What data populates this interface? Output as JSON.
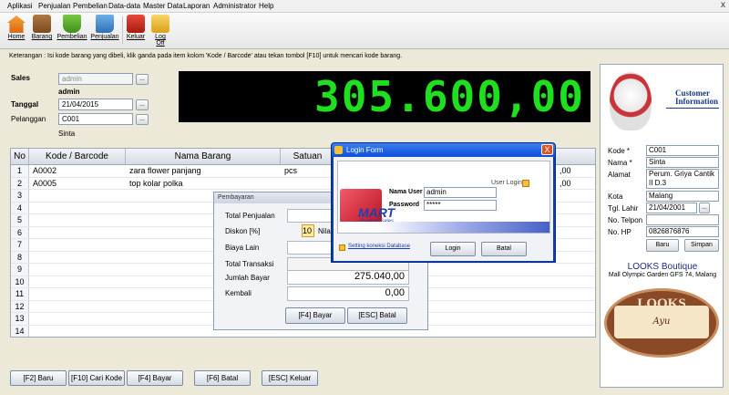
{
  "menu": {
    "items": [
      "Aplikasi",
      "Penjualan",
      "Pembelian",
      "Data-data",
      "Master Data",
      "Laporan",
      "Administrator",
      "Help"
    ],
    "close": "x"
  },
  "toolbar": {
    "buttons": [
      {
        "label": "Home",
        "icon": "home-icon"
      },
      {
        "label": "Barang",
        "icon": "box-icon"
      },
      {
        "label": "Pembelian",
        "icon": "basket-icon"
      },
      {
        "label": "Penjualan",
        "icon": "cart-icon"
      },
      {
        "label": "Keluar",
        "icon": "exit-icon"
      },
      {
        "label": "Log Off",
        "icon": "logoff-icon"
      }
    ]
  },
  "info_text": "Keterangan : Isi kode barang yang dibeli, klik ganda pada item kolom 'Kode / Barcode' atau tekan tombol [F10] untuk mencari kode barang.",
  "form": {
    "sales_label": "Sales",
    "sales_value": "admin",
    "sales_user": "admin",
    "tanggal_label": "Tanggal",
    "tanggal_value": "21/04/2015",
    "pelanggan_label": "Pelanggan",
    "pelanggan_value": "C001",
    "pelanggan_name": "Sinta",
    "browse": "..."
  },
  "total_display": "305.600,00",
  "grid": {
    "headers": [
      "No",
      "Kode / Barcode",
      "Nama Barang",
      "Satuan"
    ],
    "rows": [
      {
        "no": "1",
        "kode": "A0002",
        "nama": "zara flower panjang",
        "satuan": "pcs",
        "tail": ",00"
      },
      {
        "no": "2",
        "kode": "A0005",
        "nama": "top kolar polka",
        "satuan": "",
        "tail": ",00"
      },
      {
        "no": "3"
      },
      {
        "no": "4"
      },
      {
        "no": "5"
      },
      {
        "no": "6"
      },
      {
        "no": "7"
      },
      {
        "no": "8"
      },
      {
        "no": "9"
      },
      {
        "no": "10"
      },
      {
        "no": "11"
      },
      {
        "no": "12"
      },
      {
        "no": "13"
      },
      {
        "no": "14"
      }
    ]
  },
  "pembayaran": {
    "title": "Pembayaran",
    "total_penjualan_label": "Total Penjualan",
    "diskon_label": "Diskon [%]",
    "diskon_value": "10",
    "nilai_label": "Nilai",
    "biaya_lain_label": "Biaya Lain",
    "total_transaksi_label": "Total Transaksi",
    "jumlah_bayar_label": "Jumlah Bayar",
    "jumlah_bayar_value": "275.040,00",
    "kembali_label": "Kembali",
    "kembali_value": "0,00",
    "bayar_button": "[F4] Bayar",
    "batal_button": "[ESC] Batal"
  },
  "login": {
    "title": "Login Form",
    "close": "X",
    "header_label": "User Login",
    "nama_user_label": "Nama User",
    "nama_user_value": "admin",
    "password_label": "Password",
    "password_value": "*****",
    "brand": "MART",
    "brand_tag": "Point of Sales",
    "setting_link": "Setting koneksi Database",
    "login_button": "Login",
    "batal_button": "Batal"
  },
  "customer": {
    "heading_line1": "Customer",
    "heading_line2": "Information",
    "kode_label": "Kode *",
    "kode_value": "C001",
    "nama_label": "Nama *",
    "nama_value": "Sinta",
    "alamat_label": "Alamat",
    "alamat_value": "Perum. Griya Cantik II D.3",
    "kota_label": "Kota",
    "kota_value": "Malang",
    "tgl_lahir_label": "Tgl. Lahir",
    "tgl_lahir_value": "21/04/2001",
    "telpon_label": "No. Telpon",
    "telpon_value": "",
    "hp_label": "No. HP",
    "hp_value": "0826876876",
    "baru_button": "Baru",
    "simpan_button": "Simpan",
    "store_name": "LOOKS Boutique",
    "store_address": "Mall Olympic Garden GFS 74, Malang",
    "logo_text": "LOOKS",
    "logo_sub": "Ayu"
  },
  "bottom_buttons": [
    "[F2] Baru",
    "[F10] Cari Kode",
    "[F4] Bayar",
    "[F6] Batal",
    "[ESC] Keluar"
  ],
  "colors": {
    "display_bg": "#000000",
    "display_fg": "#1fe01f",
    "login_title": "#0a4fd8",
    "accent_red": "#e05020"
  }
}
